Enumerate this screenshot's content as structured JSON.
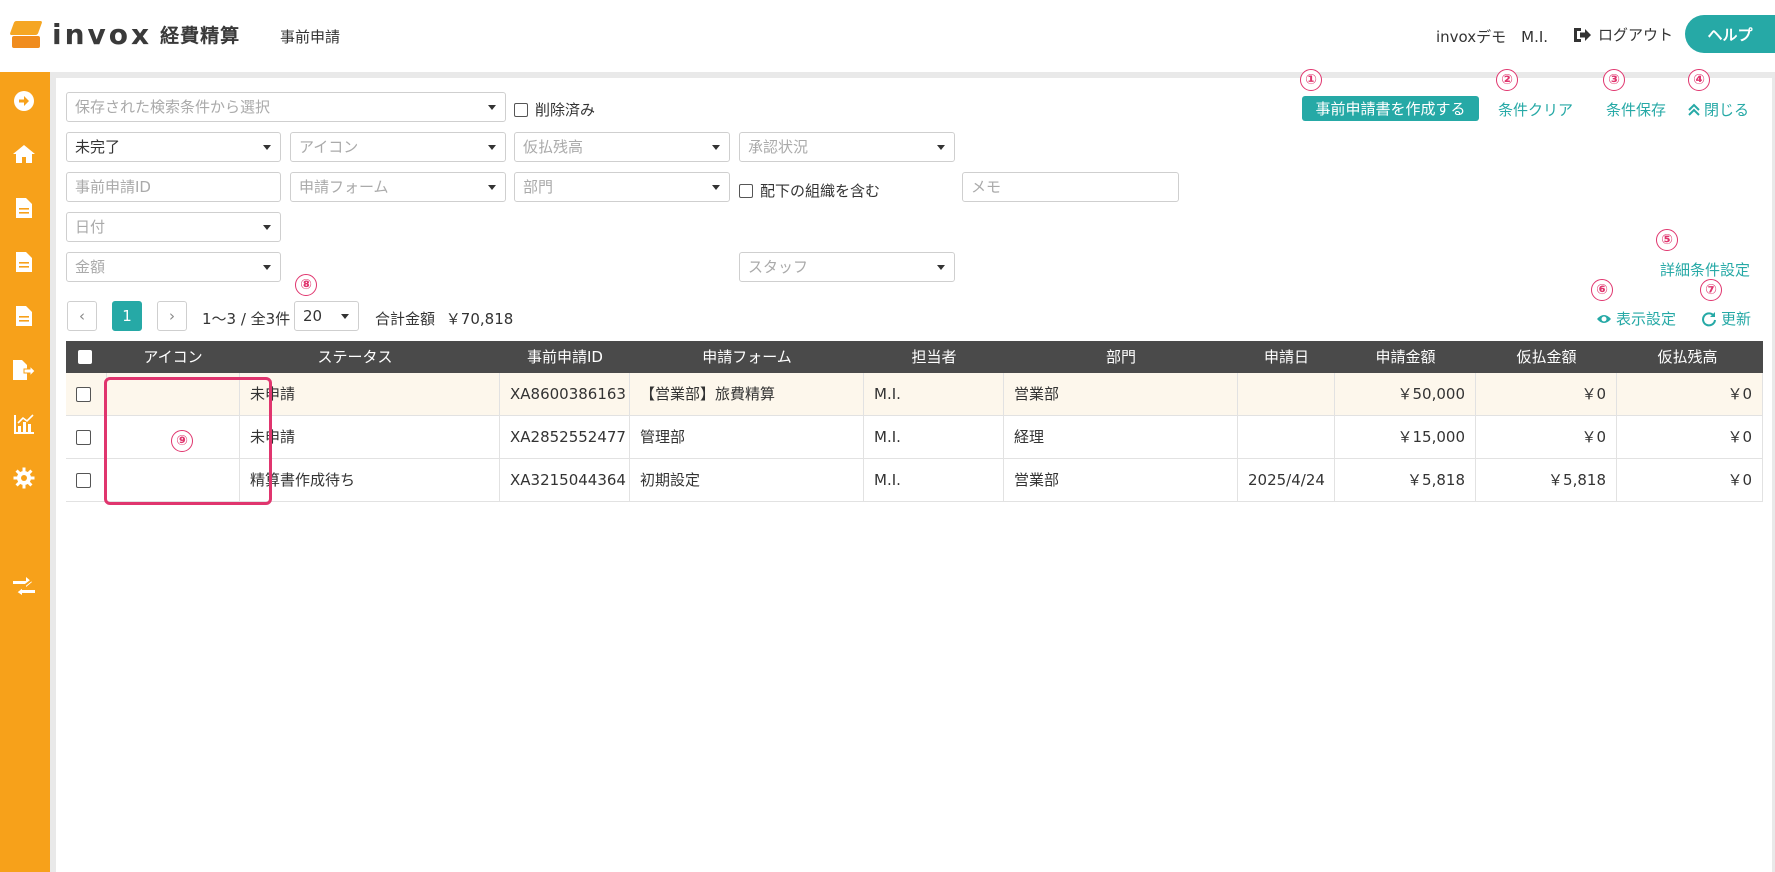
{
  "header": {
    "logo_text": "invox",
    "logo_sub": "経費精算",
    "page_title": "事前申請",
    "user": "invoxデモ　M.I.",
    "logout_label": "ログアウト",
    "help_label": "ヘルプ"
  },
  "sidebar": {
    "icons": [
      "arrow-circle-icon",
      "home-icon",
      "document-icon",
      "document-icon",
      "document-icon",
      "export-document-icon",
      "chart-icon",
      "gear-icon",
      "transfer-icon"
    ]
  },
  "filters": {
    "saved_search_placeholder": "保存された検索条件から選択",
    "deleted_label": "削除済み",
    "status_value": "未完了",
    "icon_placeholder": "アイコン",
    "advance_balance_placeholder": "仮払残高",
    "approval_status_placeholder": "承認状況",
    "application_id_placeholder": "事前申請ID",
    "form_placeholder": "申請フォーム",
    "department_placeholder": "部門",
    "include_subordinates_label": "配下の組織を含む",
    "memo_placeholder": "メモ",
    "date_placeholder": "日付",
    "amount_placeholder": "金額",
    "staff_placeholder": "スタッフ"
  },
  "actions": {
    "create_label": "事前申請書を作成する",
    "clear_label": "条件クリア",
    "save_label": "条件保存",
    "close_label": "閉じる",
    "advanced_label": "詳細条件設定",
    "display_settings_label": "表示設定",
    "refresh_label": "更新"
  },
  "badges": [
    "①",
    "②",
    "③",
    "④",
    "⑤",
    "⑥",
    "⑦",
    "⑧",
    "⑨"
  ],
  "pagination": {
    "prev": "‹",
    "current": "1",
    "next": "›",
    "range": "1〜3 / 全3件",
    "page_size": "20",
    "total_label": "合計金額",
    "total_value": "￥70,818"
  },
  "table": {
    "columns": [
      "アイコン",
      "ステータス",
      "事前申請ID",
      "申請フォーム",
      "担当者",
      "部門",
      "申請日",
      "申請金額",
      "仮払金額",
      "仮払残高"
    ],
    "rows": [
      {
        "status": "未申請",
        "id": "XA8600386163",
        "form": "【営業部】旅費精算",
        "owner": "M.I.",
        "department": "営業部",
        "date": "",
        "amount": "￥50,000",
        "advance": "￥0",
        "balance": "￥0"
      },
      {
        "status": "未申請",
        "id": "XA2852552477",
        "form": "管理部",
        "owner": "M.I.",
        "department": "経理",
        "date": "",
        "amount": "￥15,000",
        "advance": "￥0",
        "balance": "￥0"
      },
      {
        "status": "精算書作成待ち",
        "id": "XA3215044364",
        "form": "初期設定",
        "owner": "M.I.",
        "department": "営業部",
        "date": "2025/4/24",
        "amount": "￥5,818",
        "advance": "￥5,818",
        "balance": "￥0"
      }
    ]
  },
  "colors": {
    "accent": "#26A9A6",
    "sidebar": "#F7A11A",
    "annotation": "#E0356E",
    "table_header": "#4a4a4a"
  }
}
